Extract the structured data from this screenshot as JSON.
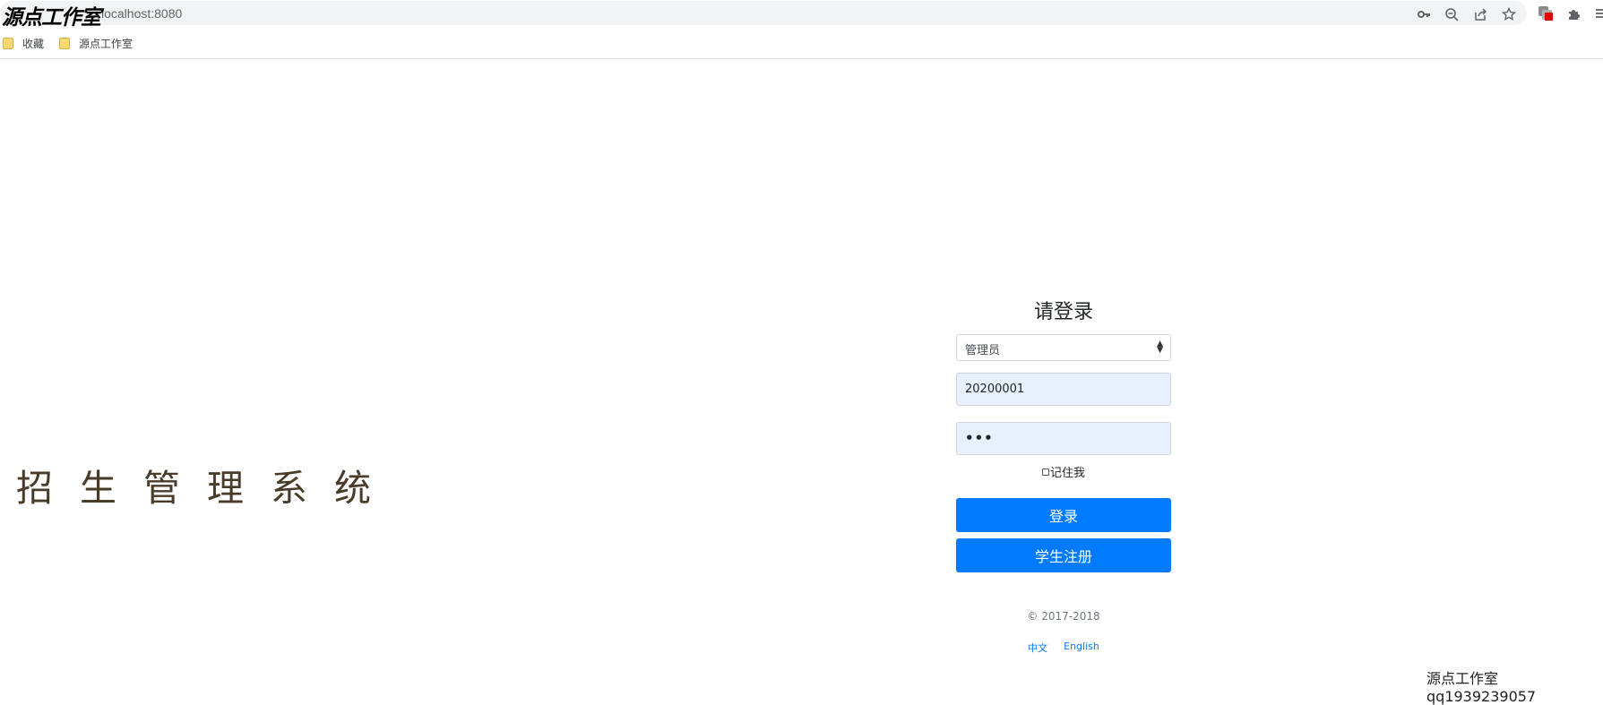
{
  "browser": {
    "url": "localhost:8080",
    "watermark_top": "源点工作室",
    "toolbar_icons": [
      "key-icon",
      "zoom-out-icon",
      "share-icon",
      "star-icon"
    ],
    "extension_icons": [
      "profile-extension-icon",
      "puzzle-icon",
      "menu-icon"
    ],
    "bookmarks": [
      {
        "label": "收藏",
        "icon": "folder-icon"
      },
      {
        "label": "源点工作室",
        "icon": "folder-icon"
      }
    ]
  },
  "page": {
    "system_title": "招生管理系统",
    "login": {
      "title": "请登录",
      "role_options": [
        "管理员"
      ],
      "role_selected": "管理员",
      "username_value": "20200001",
      "password_mask": "•••",
      "remember_label": "记住我",
      "login_button": "登录",
      "register_button": "学生注册"
    },
    "footer": {
      "copyright": "© 2017-2018",
      "lang_chinese": "中文",
      "lang_english": "English"
    },
    "watermark_bottom": "源点工作室qq1939239057"
  },
  "colors": {
    "primary": "#007bff",
    "autofill": "#e8f0fe",
    "title": "#4a3b28"
  }
}
